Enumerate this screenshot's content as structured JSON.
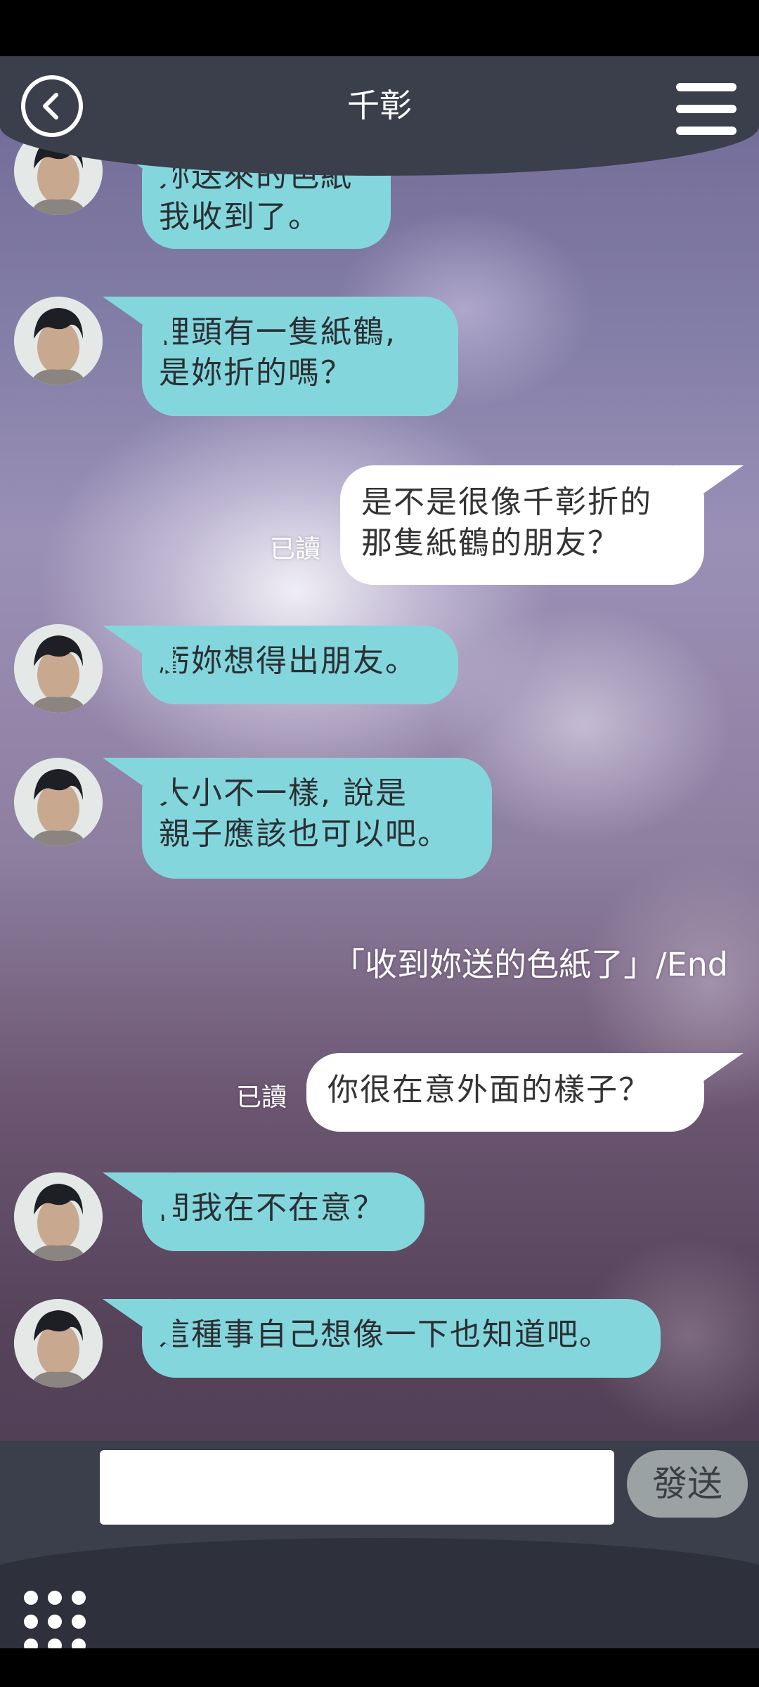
{
  "header": {
    "title": "千彰"
  },
  "messages": [
    {
      "side": "in",
      "text": "妳送來的色紙\n我收到了。"
    },
    {
      "side": "in",
      "text": "裡頭有一隻紙鶴,\n是妳折的嗎？"
    },
    {
      "side": "out",
      "text": "是不是很像千彰折的\n那隻紙鶴的朋友？",
      "read": "已讀"
    },
    {
      "side": "in",
      "text": "虧妳想得出朋友。"
    },
    {
      "side": "in",
      "text": "大小不一樣, 說是\n親子應該也可以吧。"
    },
    {
      "side": "out",
      "text": "你很在意外面的樣子？",
      "read": "已讀"
    },
    {
      "side": "in",
      "text": "問我在不在意？"
    },
    {
      "side": "in",
      "text": "這種事自己想像一下也知道吧。"
    }
  ],
  "end_note": "「收到妳送的色紙了」/End",
  "composer": {
    "placeholder": "",
    "send_label": "發送"
  }
}
